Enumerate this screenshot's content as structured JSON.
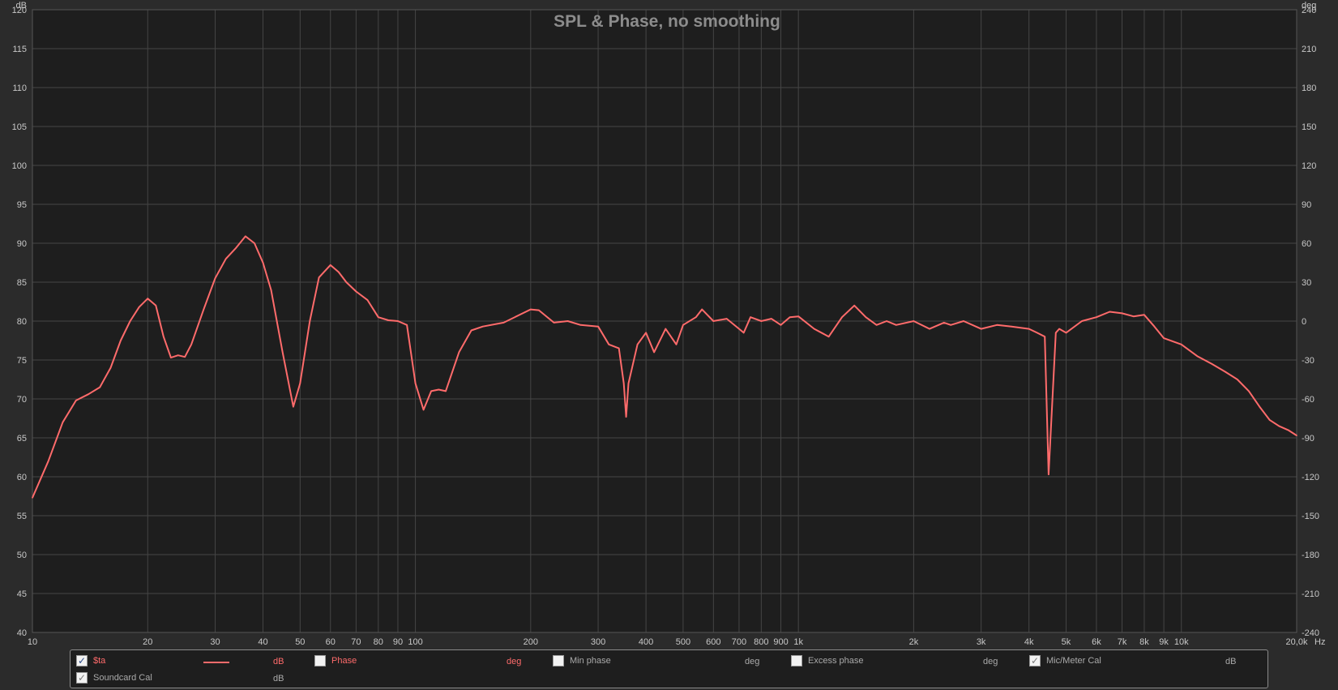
{
  "chart_data": {
    "type": "line",
    "title": "SPL & Phase, no smoothing",
    "y_left_unit": "dB",
    "y_right_unit": "deg",
    "x_unit": "Hz",
    "x_scale": "log",
    "xlim": [
      10,
      20000
    ],
    "ylim": [
      40,
      120
    ],
    "y_right_lim": [
      -240,
      240
    ],
    "y_ticks": [
      "120",
      "115",
      "110",
      "105",
      "100",
      "95",
      "90",
      "85",
      "80",
      "75",
      "70",
      "65",
      "60",
      "55",
      "50",
      "45",
      "40"
    ],
    "y_right_ticks": [
      "240",
      "210",
      "180",
      "150",
      "120",
      "90",
      "60",
      "30",
      "0",
      "-30",
      "-60",
      "-90",
      "-120",
      "-150",
      "-180",
      "-210",
      "-240"
    ],
    "x_ticks": [
      {
        "v": 10,
        "label": "10"
      },
      {
        "v": 20,
        "label": "20"
      },
      {
        "v": 30,
        "label": "30"
      },
      {
        "v": 40,
        "label": "40"
      },
      {
        "v": 50,
        "label": "50"
      },
      {
        "v": 60,
        "label": "60"
      },
      {
        "v": 70,
        "label": "70"
      },
      {
        "v": 80,
        "label": "80"
      },
      {
        "v": 90,
        "label": "90"
      },
      {
        "v": 100,
        "label": "100"
      },
      {
        "v": 200,
        "label": "200"
      },
      {
        "v": 300,
        "label": "300"
      },
      {
        "v": 400,
        "label": "400"
      },
      {
        "v": 500,
        "label": "500"
      },
      {
        "v": 600,
        "label": "600"
      },
      {
        "v": 700,
        "label": "700"
      },
      {
        "v": 800,
        "label": "800"
      },
      {
        "v": 900,
        "label": "900"
      },
      {
        "v": 1000,
        "label": "1k"
      },
      {
        "v": 2000,
        "label": "2k"
      },
      {
        "v": 3000,
        "label": "3k"
      },
      {
        "v": 4000,
        "label": "4k"
      },
      {
        "v": 5000,
        "label": "5k"
      },
      {
        "v": 6000,
        "label": "6k"
      },
      {
        "v": 7000,
        "label": "7k"
      },
      {
        "v": 8000,
        "label": "8k"
      },
      {
        "v": 9000,
        "label": "9k"
      },
      {
        "v": 10000,
        "label": "10k"
      },
      {
        "v": 20000,
        "label": "20,0k"
      }
    ],
    "grid": true,
    "series": [
      {
        "name": "$ta",
        "color": "#ff6b6b",
        "x": [
          10,
          11,
          12,
          13,
          14,
          15,
          16,
          17,
          18,
          19,
          20,
          21,
          22,
          23,
          24,
          25,
          26,
          28,
          30,
          32,
          34,
          36,
          38,
          40,
          42,
          45,
          48,
          50,
          53,
          56,
          60,
          63,
          66,
          70,
          75,
          80,
          85,
          90,
          95,
          100,
          105,
          110,
          115,
          120,
          130,
          140,
          150,
          170,
          200,
          210,
          230,
          250,
          270,
          300,
          320,
          340,
          350,
          355,
          360,
          380,
          400,
          420,
          450,
          480,
          500,
          540,
          560,
          600,
          650,
          700,
          720,
          750,
          800,
          850,
          900,
          950,
          1000,
          1100,
          1200,
          1300,
          1400,
          1500,
          1600,
          1700,
          1800,
          2000,
          2200,
          2400,
          2500,
          2700,
          3000,
          3300,
          3600,
          4000,
          4200,
          4400,
          4500,
          4700,
          4800,
          5000,
          5500,
          6000,
          6500,
          7000,
          7500,
          8000,
          8500,
          9000,
          10000,
          11000,
          12000,
          13000,
          14000,
          15000,
          16000,
          17000,
          18000,
          19000,
          20000
        ],
        "y": [
          57.3,
          62,
          67,
          69.8,
          70.6,
          71.5,
          74,
          77.5,
          80,
          81.8,
          82.9,
          82,
          78,
          75.3,
          75.6,
          75.4,
          77,
          81.5,
          85.5,
          88,
          89.4,
          90.9,
          90,
          87.5,
          84,
          76,
          69,
          72,
          80,
          85.6,
          87.2,
          86.3,
          85,
          83.8,
          82.7,
          80.5,
          80.1,
          80,
          79.5,
          72,
          68.6,
          71,
          71.2,
          71,
          76,
          78.8,
          79.3,
          79.8,
          81.5,
          81.4,
          79.8,
          80,
          79.5,
          79.3,
          77,
          76.5,
          72,
          67.7,
          72,
          77,
          78.5,
          76,
          79,
          77,
          79.5,
          80.5,
          81.5,
          80,
          80.3,
          79,
          78.5,
          80.5,
          80,
          80.3,
          79.5,
          80.5,
          80.6,
          79,
          78,
          80.5,
          82,
          80.5,
          79.5,
          80,
          79.5,
          80,
          79,
          79.8,
          79.5,
          80,
          79,
          79.5,
          79.3,
          79,
          78.5,
          78,
          60.3,
          78.5,
          79,
          78.5,
          80,
          80.5,
          81.2,
          81,
          80.6,
          80.8,
          79.3,
          77.8,
          77,
          75.5,
          74.5,
          73.5,
          72.5,
          71,
          69,
          67.3,
          66.5,
          66,
          65.3
        ]
      }
    ]
  },
  "legend": {
    "items": [
      {
        "label": "$ta",
        "unit": "dB",
        "checked": true
      },
      {
        "label": "Phase",
        "unit": "deg",
        "checked": false
      },
      {
        "label": "Min phase",
        "unit": "deg",
        "checked": false
      },
      {
        "label": "Excess phase",
        "unit": "deg",
        "checked": false
      },
      {
        "label": "Mic/Meter Cal",
        "unit": "dB",
        "checked": true
      },
      {
        "label": "Soundcard Cal",
        "unit": "dB",
        "checked": true
      }
    ]
  },
  "colors": {
    "background": "#2b2b2b",
    "plot_background": "#1e1e1e",
    "grid": "#4a4a4a",
    "trace": "#ff6b6b"
  }
}
